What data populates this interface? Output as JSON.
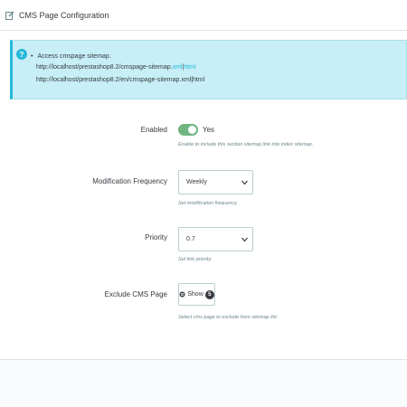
{
  "panel": {
    "title": "CMS Page Configuration",
    "icons": {
      "title": "edit-icon",
      "alert": "help-icon"
    }
  },
  "alert": {
    "bullet": "Access cmspage sitemap.",
    "url1_prefix": "http://localhost/prestashop8.2/cmspage-sitemap.",
    "url1_link": "xml",
    "url1_sep": "|",
    "url1_suffix": "html",
    "url2": "http://localhost/prestashop8.2/en/cmspage-sitemap.xml|html",
    "colors": {
      "background": "#c8eff7",
      "accent": "#25b9d7"
    }
  },
  "fields": {
    "enabled": {
      "label": "Enabled",
      "toggle_state": "Yes",
      "on": true,
      "help": "Enable to include this section sitemap link into index sitemap."
    },
    "frequency": {
      "label": "Modification Frequency",
      "value": "Weekly",
      "help": "Set modification frequency."
    },
    "priority": {
      "label": "Priority",
      "value": "0.7",
      "help": "Set link priority."
    },
    "exclude": {
      "label": "Exclude CMS Page",
      "button_label": "Show",
      "count": "5",
      "help": "Select cms page to exclude from sitemap list."
    }
  },
  "colors": {
    "toggle_on": "#70b580",
    "help_text": "#6c868e"
  }
}
